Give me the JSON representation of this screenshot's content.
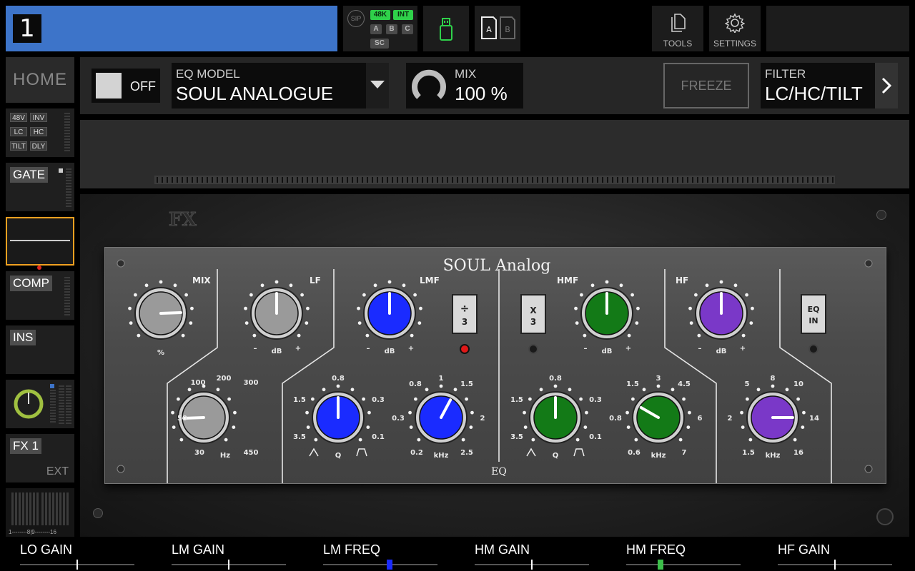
{
  "channel": {
    "number": "1",
    "color": "#3d74c9"
  },
  "status": {
    "sip": "SIP",
    "rate": "48K",
    "clock": "INT",
    "buses": [
      "A",
      "B",
      "C"
    ],
    "sc": "SC"
  },
  "usb": {
    "icon": "usb-drive-icon"
  },
  "ab": {
    "a": "A",
    "b": "B"
  },
  "top_buttons": {
    "tools": "TOOLS",
    "settings": "SETTINGS"
  },
  "left_strip": {
    "home": "HOME",
    "input_tags": [
      "48V",
      "INV",
      "LC",
      "HC",
      "TILT",
      "DLY"
    ],
    "gate": "GATE",
    "comp": "COMP",
    "ins": "INS",
    "fx": "FX 1",
    "ext": "EXT",
    "meter_scale": "1--------8|9--------16"
  },
  "params": {
    "on_label": "OFF",
    "eq_model_label": "EQ MODEL",
    "eq_model_value": "SOUL ANALOGUE",
    "mix_label": "MIX",
    "mix_value": "100 %",
    "mix_level": 1.0,
    "freeze": "FREEZE",
    "filter_label": "FILTER",
    "filter_value": "LC/HC/TILT"
  },
  "plugin": {
    "logo": "FX",
    "title": "SOUL Analog",
    "footer": "EQ",
    "sections": {
      "mix": "MIX",
      "lf": "LF",
      "lmf": "LMF",
      "hmf": "HMF",
      "hf": "HF"
    },
    "knob_labels": {
      "percent": "%",
      "db": "dB",
      "minus": "–",
      "plus": "+",
      "hz": "Hz",
      "q": "Q",
      "khz": "kHz"
    },
    "lf_freq_scale": [
      "100",
      "200",
      "300",
      "50",
      "30",
      "450"
    ],
    "lmf_q_scale": [
      "0.8",
      "1.5",
      "0.3",
      "3.5",
      "0.1"
    ],
    "lmf_freq_scale": [
      "0.8",
      "1",
      "1.5",
      "0.3",
      "2",
      "0.2",
      "2.5"
    ],
    "hmf_q_scale": [
      "0.8",
      "1.5",
      "0.3",
      "3.5",
      "0.1"
    ],
    "hmf_freq_scale": [
      "1.5",
      "3",
      "4.5",
      "0.8",
      "6",
      "0.6",
      "7"
    ],
    "hf_freq_scale": [
      "5",
      "8",
      "10",
      "2",
      "14",
      "1.5",
      "16"
    ],
    "div3_button": "÷\n3",
    "x3_button": "X\n3",
    "eqin_button": "EQ\nIN"
  },
  "bottom": {
    "lo_gain": "LO GAIN",
    "lm_gain": "LM GAIN",
    "lm_freq": "LM FREQ",
    "hm_gain": "HM GAIN",
    "hm_freq": "HM FREQ",
    "hf_gain": "HF GAIN"
  },
  "bottom_levels": {
    "lo_gain": 0.5,
    "lm_gain": 0.5,
    "lm_freq": 0.58,
    "hm_gain": 0.5,
    "hm_freq": 0.3,
    "hf_gain": 0.5
  },
  "colors": {
    "accent_blue": "#3d74c9",
    "select_orange": "#f0a020",
    "lmf_blue": "#1a2bff",
    "hmf_green": "#137a17",
    "hf_purple": "#7a38c8",
    "status_green": "#2fd14a"
  }
}
